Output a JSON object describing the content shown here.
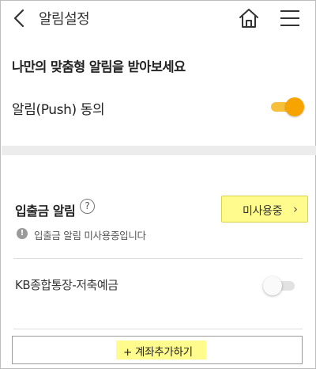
{
  "header": {
    "title": "알림설정",
    "icons": [
      "back-icon",
      "home-icon",
      "menu-icon"
    ]
  },
  "intro": {
    "subtitle": "나만의 맞춤형 알림을 받아보세요"
  },
  "push": {
    "label": "알림(Push) 동의",
    "enabled": true
  },
  "deposit_alert": {
    "title": "입출금 알림",
    "help_icon": "?",
    "button_label": "미사용중",
    "button_chevron": "›",
    "info_icon": "!",
    "info_text": "입출금 알림 미사용중입니다"
  },
  "accounts": [
    {
      "name": "KB종합통장-저축예금",
      "enabled": false
    }
  ],
  "add_account": {
    "label": "+ 계좌추가하기"
  },
  "colors": {
    "toggle_on": "#f7a300",
    "highlight": "#fffb8c",
    "divider": "#ececec"
  }
}
